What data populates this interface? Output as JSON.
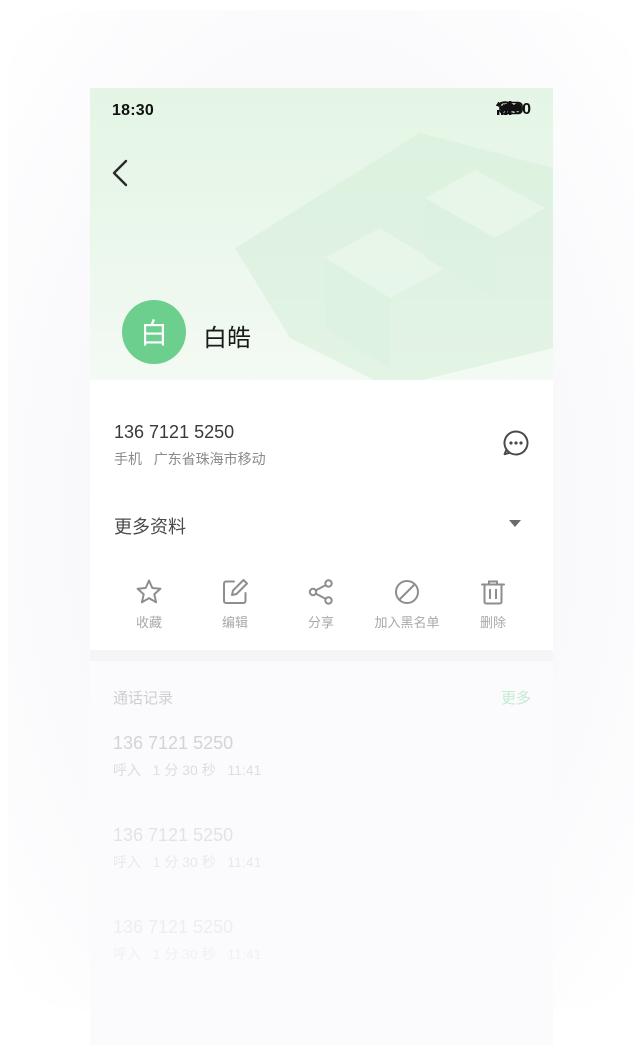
{
  "status_bar": {
    "time": "18:30",
    "network": "4G",
    "battery": "100",
    "icons": [
      "wifi-icon",
      "signal-icon",
      "battery-icon"
    ]
  },
  "contact": {
    "avatar_char": "白",
    "name": "白皓",
    "phone": "136 7121 5250",
    "phone_type": "手机",
    "location": "广东省珠海市移动",
    "more_info_label": "更多资料"
  },
  "actions": [
    {
      "label": "收藏",
      "icon": "star-icon"
    },
    {
      "label": "编辑",
      "icon": "edit-icon"
    },
    {
      "label": "分享",
      "icon": "share-icon"
    },
    {
      "label": "加入黑名单",
      "icon": "block-icon"
    },
    {
      "label": "删除",
      "icon": "trash-icon"
    }
  ],
  "call_log": {
    "title": "通话记录",
    "more_label": "更多",
    "items": [
      {
        "number": "136 7121 5250",
        "direction": "呼入",
        "duration": "1 分 30 秒",
        "time": "11:41"
      },
      {
        "number": "136 7121 5250",
        "direction": "呼入",
        "duration": "1 分 30 秒",
        "time": "11:41"
      },
      {
        "number": "136 7121 5250",
        "direction": "呼入",
        "duration": "1 分 30 秒",
        "time": "11:41"
      }
    ]
  },
  "colors": {
    "avatar": "#6ccf8d",
    "accent_green": "#c4ead0",
    "hero_background": "#e4f5e5"
  }
}
